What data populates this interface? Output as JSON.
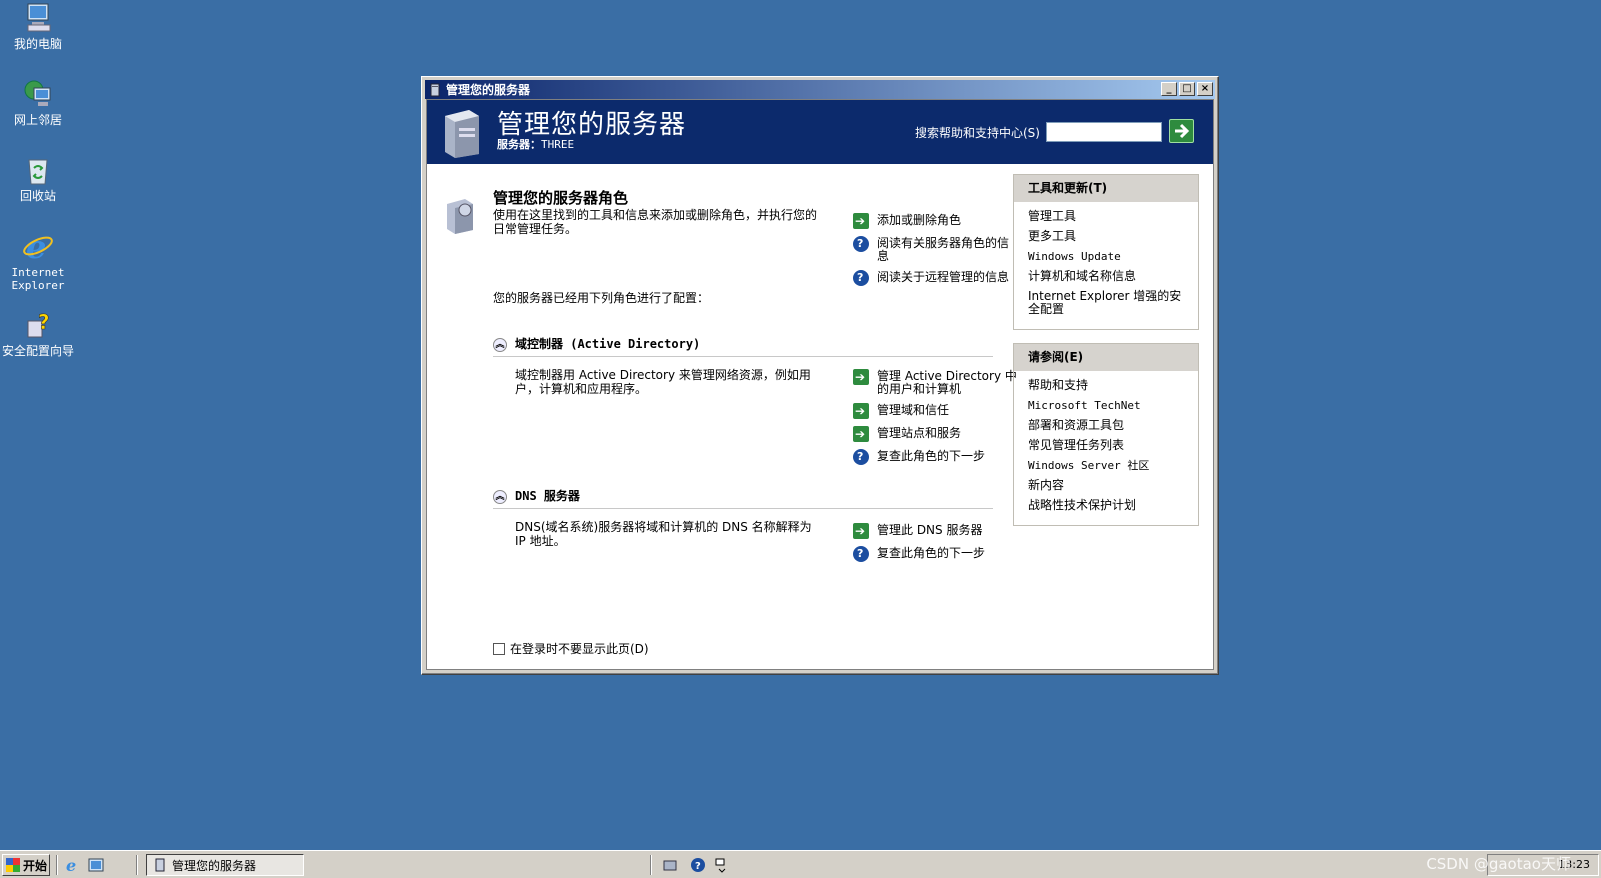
{
  "desktop": {
    "icons": [
      {
        "label": "我的电脑"
      },
      {
        "label": "网上邻居"
      },
      {
        "label": "回收站"
      },
      {
        "label": "Internet Explorer"
      },
      {
        "label": "安全配置向导"
      }
    ]
  },
  "window": {
    "title": "管理您的服务器",
    "controls": {
      "minimize": "_",
      "maximize": "□",
      "close": "×"
    },
    "banner": {
      "title": "管理您的服务器",
      "server_label": "服务器：",
      "server_name": "THREE",
      "search_label": "搜索帮助和支持中心(S)",
      "search_value": ""
    },
    "main": {
      "title": "管理您的服务器角色",
      "description": "使用在这里找到的工具和信息来添加或删除角色，并执行您的日常管理任务。",
      "top_links": [
        {
          "label": "添加或删除角色",
          "icon": "arrow"
        },
        {
          "label": "阅读有关服务器角色的信息",
          "icon": "help"
        },
        {
          "label": "阅读关于远程管理的信息",
          "icon": "help"
        }
      ],
      "configured_text": "您的服务器已经用下列角色进行了配置：",
      "roles": [
        {
          "title": "域控制器 (Active Directory)",
          "description": "域控制器用 Active Directory 来管理网络资源，例如用户，计算机和应用程序。",
          "links": [
            {
              "label": "管理 Active Directory 中的用户和计算机",
              "icon": "arrow"
            },
            {
              "label": "管理域和信任",
              "icon": "arrow"
            },
            {
              "label": "管理站点和服务",
              "icon": "arrow"
            },
            {
              "label": "复查此角色的下一步",
              "icon": "help"
            }
          ]
        },
        {
          "title": "DNS 服务器",
          "description": "DNS(域名系统)服务器将域和计算机的 DNS 名称解释为 IP 地址。",
          "links": [
            {
              "label": "管理此 DNS 服务器",
              "icon": "arrow"
            },
            {
              "label": "复查此角色的下一步",
              "icon": "help"
            }
          ]
        }
      ],
      "checkbox_label": "在登录时不要显示此页(D)",
      "checkbox_checked": false
    },
    "side": {
      "tools": {
        "title": "工具和更新(T)",
        "items": [
          "管理工具",
          "更多工具",
          "Windows Update",
          "计算机和域名称信息",
          "Internet Explorer 增强的安全配置"
        ]
      },
      "see_also": {
        "title": "请参阅(E)",
        "items": [
          "帮助和支持",
          "Microsoft TechNet",
          "部署和资源工具包",
          "常见管理任务列表",
          "Windows Server 社区",
          "新内容",
          "战略性技术保护计划"
        ]
      }
    }
  },
  "taskbar": {
    "start_label": "开始",
    "task_item": "管理您的服务器",
    "clock": "13:23"
  },
  "watermark": "CSDN @gaotao天师"
}
